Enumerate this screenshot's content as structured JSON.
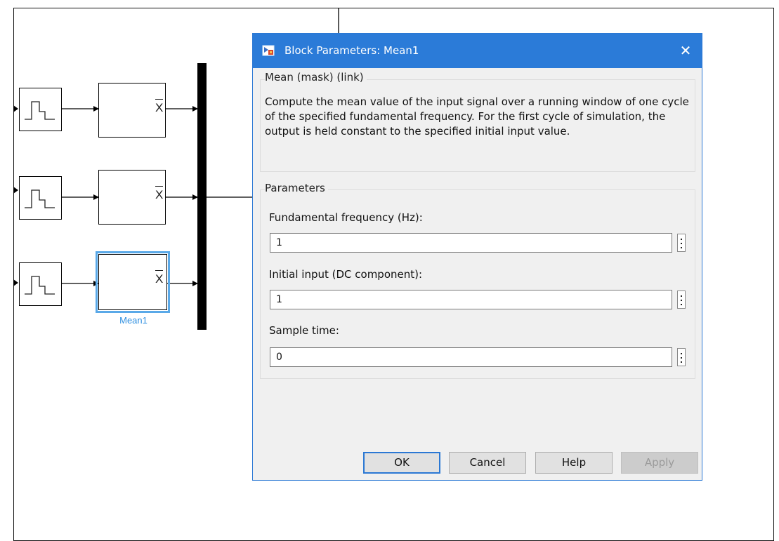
{
  "model": {
    "selected_block_label": "Mean1",
    "mean_block_symbol": "X"
  },
  "dialog": {
    "title": "Block Parameters: Mean1",
    "close_glyph": "✕",
    "mask_group_title": "Mean (mask) (link)",
    "description": "Compute the mean value of the input signal over a running window of one cycle of the specified fundamental frequency. For the first cycle of simulation, the output is held constant to the specified initial input value.",
    "parameters_group_title": "Parameters",
    "fields": [
      {
        "label": "Fundamental frequency (Hz):",
        "value": "1"
      },
      {
        "label": "Initial input (DC component):",
        "value": "1"
      },
      {
        "label": "Sample time:",
        "value": "0"
      }
    ],
    "buttons": {
      "ok": "OK",
      "cancel": "Cancel",
      "help": "Help",
      "apply": "Apply"
    }
  },
  "icons": {
    "title_icon": "simulink-block-icon",
    "close_icon": "close-icon",
    "field_menu_icon": "vertical-ellipsis-icon",
    "step_icon": "step-signal-icon"
  },
  "colors": {
    "title_bar": "#2b7bd8",
    "selection": "#5aa9e8",
    "selected_label": "#2e8fe0",
    "dialog_bg": "#f0f0f0"
  }
}
